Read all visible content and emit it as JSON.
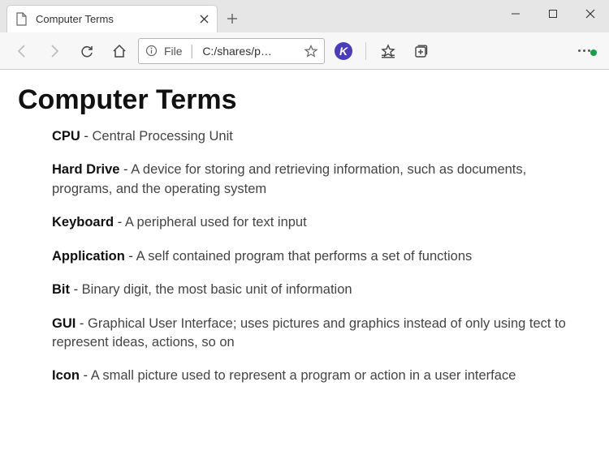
{
  "window": {
    "tab_title": "Computer Terms"
  },
  "address": {
    "protocol_label": "File",
    "path": "C:/shares/p…"
  },
  "page": {
    "heading": "Computer Terms",
    "terms": [
      {
        "term": "CPU",
        "def": "Central Processing Unit"
      },
      {
        "term": "Hard Drive",
        "def": "A device for storing and retrieving information, such as documents, programs, and the operating system"
      },
      {
        "term": "Keyboard",
        "def": "A peripheral used for text input"
      },
      {
        "term": "Application",
        "def": "A self contained program that performs a set of functions"
      },
      {
        "term": "Bit",
        "def": "Binary digit, the most basic unit of information"
      },
      {
        "term": "GUI",
        "def": "Graphical User Interface; uses pictures and graphics instead of only using tect to represent ideas, actions, so on"
      },
      {
        "term": "Icon",
        "def": "A small picture used to represent a program or action in a user interface"
      }
    ]
  },
  "ext": {
    "label": "K"
  }
}
